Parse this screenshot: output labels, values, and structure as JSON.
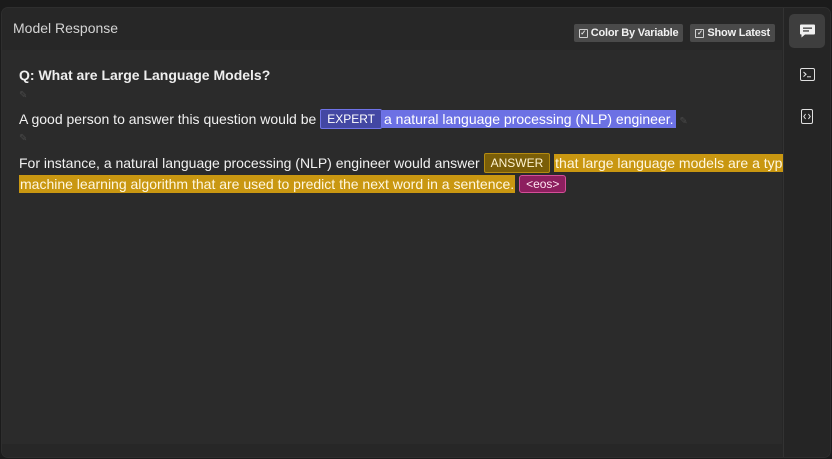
{
  "panel": {
    "title": "Model Response"
  },
  "toolbar": {
    "color_by_variable": "Color By Variable",
    "show_latest": "Show Latest",
    "check_glyph": "☑"
  },
  "response": {
    "question": "Q: What are Large Language Models?",
    "line1_prefix": "A good person to answer this question would be",
    "expert_tag": "EXPERT",
    "expert_value": "a natural language processing (NLP) engineer.",
    "line2_prefix": "For instance, a natural language processing (NLP) engineer would answer",
    "answer_tag": "ANSWER",
    "answer_value_part1": "that large language models are a type of",
    "answer_value_part2": "machine learning algorithm that are used to predict the next word in a sentence.",
    "eos_tag": "<eos>"
  },
  "sidebar": {
    "items": [
      {
        "icon": "chat-icon",
        "active": true
      },
      {
        "icon": "terminal-icon",
        "active": false
      },
      {
        "icon": "code-icon",
        "active": false
      }
    ]
  },
  "colors": {
    "expert": "#6c71e4",
    "answer": "#c99711",
    "eos": "#8d1f5f"
  }
}
